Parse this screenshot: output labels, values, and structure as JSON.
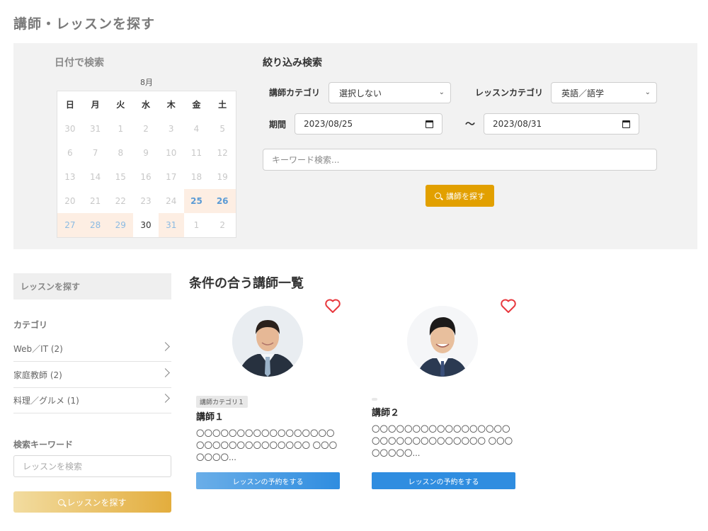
{
  "page": {
    "title": "講師・レッスンを探す"
  },
  "calendar": {
    "title": "日付で検索",
    "month": "8月",
    "weekdays": [
      "日",
      "月",
      "火",
      "水",
      "木",
      "金",
      "土"
    ],
    "weeks": [
      [
        "30",
        "31",
        "1",
        "2",
        "3",
        "4",
        "5"
      ],
      [
        "6",
        "7",
        "8",
        "9",
        "10",
        "11",
        "12"
      ],
      [
        "13",
        "14",
        "15",
        "16",
        "17",
        "18",
        "19"
      ],
      [
        "20",
        "21",
        "22",
        "23",
        "24",
        "25",
        "26"
      ],
      [
        "27",
        "28",
        "29",
        "30",
        "31",
        "1",
        "2"
      ]
    ]
  },
  "filter": {
    "title": "絞り込み検索",
    "instructor_category_label": "講師カテゴリ",
    "instructor_category_value": "選択しない",
    "lesson_category_label": "レッスンカテゴリ",
    "lesson_category_value": "英語／語学",
    "period_label": "期間",
    "date_from": "2023/08/25",
    "tilde": "〜",
    "date_to": "2023/08/31",
    "keyword_placeholder": "キーワード検索...",
    "search_button": "講師を探す"
  },
  "sidebar": {
    "header": "レッスンを探す",
    "category_label": "カテゴリ",
    "categories": [
      {
        "label": "Web／IT (2)"
      },
      {
        "label": "家庭教師 (2)"
      },
      {
        "label": "料理／グルメ (1)"
      }
    ],
    "keyword_label": "検索キーワード",
    "keyword_placeholder": "レッスンを検索",
    "search_button": "レッスンを探す"
  },
  "results": {
    "title": "条件の合う講師一覧",
    "teachers": [
      {
        "tag": "講師カテゴリ１",
        "name": "講師１",
        "description": "〇〇〇〇〇〇〇〇〇〇〇〇〇〇〇〇〇〇〇〇〇〇〇〇〇〇〇〇〇〇〇 〇〇〇〇〇〇〇...",
        "button": "レッスンの予約をする"
      },
      {
        "tag": "",
        "name": "講師２",
        "description": "〇〇〇〇〇〇〇〇〇〇〇〇〇〇〇〇〇〇〇〇〇〇〇〇〇〇〇〇〇〇〇 〇〇〇〇〇〇〇〇...",
        "button": "レッスンの予約をする"
      }
    ]
  },
  "colors": {
    "accent_orange": "#e2a000",
    "link_blue": "#5b9bd5",
    "button_blue": "#2f8de0",
    "heart_red": "#e8383d"
  }
}
